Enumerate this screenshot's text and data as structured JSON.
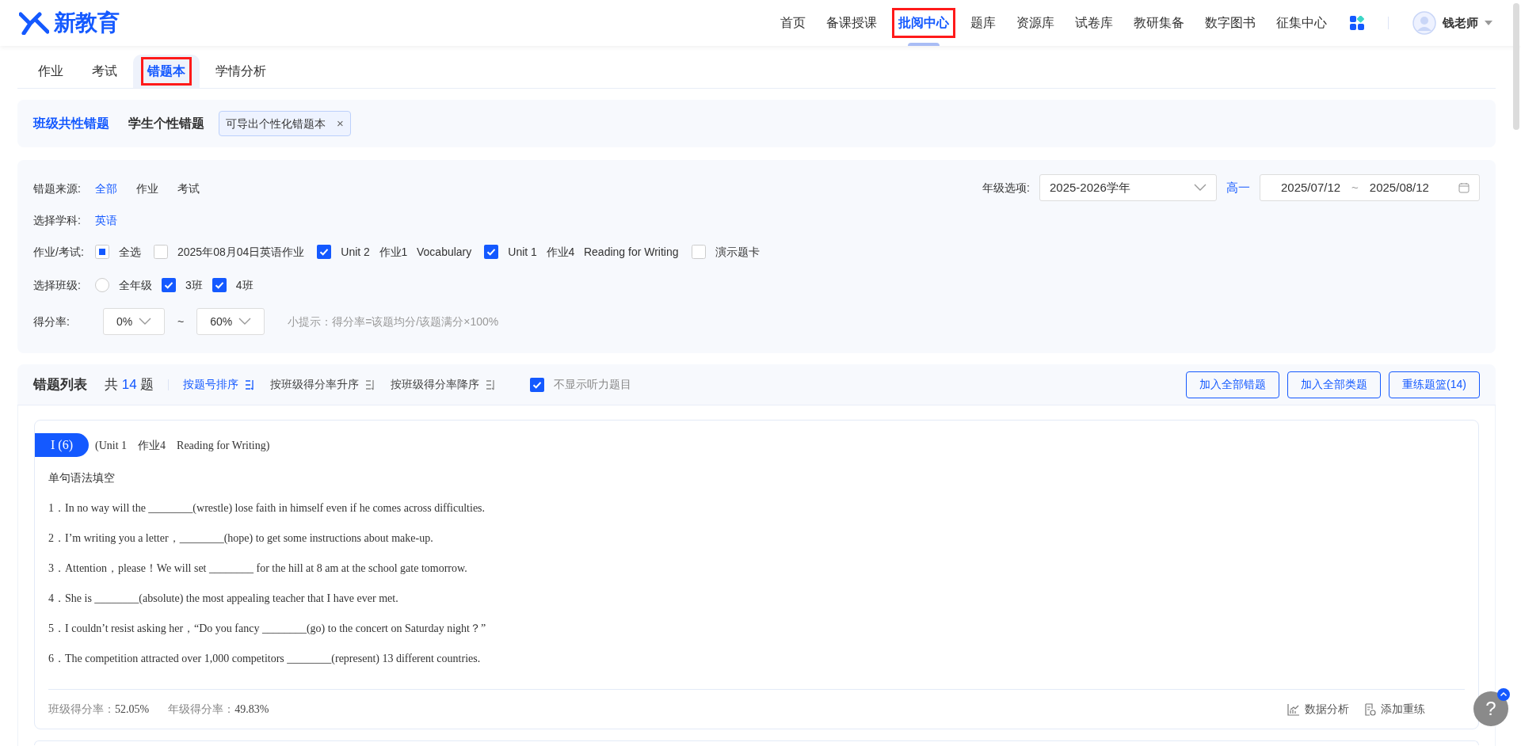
{
  "header": {
    "logo": "新教育",
    "nav": [
      {
        "label": "首页",
        "selected": false,
        "highlighted": false
      },
      {
        "label": "备课授课",
        "selected": false,
        "highlighted": false
      },
      {
        "label": "批阅中心",
        "selected": true,
        "highlighted": true
      },
      {
        "label": "题库",
        "selected": false,
        "highlighted": false
      },
      {
        "label": "资源库",
        "selected": false,
        "highlighted": false
      },
      {
        "label": "试卷库",
        "selected": false,
        "highlighted": false
      },
      {
        "label": "教研集备",
        "selected": false,
        "highlighted": false
      },
      {
        "label": "数字图书",
        "selected": false,
        "highlighted": false
      },
      {
        "label": "征集中心",
        "selected": false,
        "highlighted": false
      }
    ],
    "user": "钱老师"
  },
  "tabs": [
    {
      "label": "作业",
      "selected": false,
      "highlighted": false
    },
    {
      "label": "考试",
      "selected": false,
      "highlighted": false
    },
    {
      "label": "错题本",
      "selected": true,
      "highlighted": true
    },
    {
      "label": "学情分析",
      "selected": false,
      "highlighted": false
    }
  ],
  "modes": [
    {
      "label": "班级共性错题",
      "selected": true
    },
    {
      "label": "学生个性错题",
      "selected": false
    }
  ],
  "tip_tag": {
    "text": "可导出个性化错题本",
    "close": "×"
  },
  "filters": {
    "source": {
      "label": "错题来源:",
      "options": [
        {
          "label": "全部",
          "selected": true
        },
        {
          "label": "作业",
          "selected": false
        },
        {
          "label": "考试",
          "selected": false
        }
      ]
    },
    "subject": {
      "label": "选择学科:",
      "options": [
        {
          "label": "英语",
          "selected": true
        }
      ]
    },
    "assignments": {
      "label": "作业/考试:",
      "items": [
        {
          "parts": [
            "全选"
          ],
          "checked": false,
          "indeterminate": true
        },
        {
          "parts": [
            "2025年08月04日英语作业"
          ],
          "checked": false,
          "indeterminate": false
        },
        {
          "parts": [
            "Unit 2",
            "作业1",
            "Vocabulary"
          ],
          "checked": true,
          "indeterminate": false
        },
        {
          "parts": [
            "Unit 1",
            "作业4",
            "Reading for Writing"
          ],
          "checked": true,
          "indeterminate": false
        },
        {
          "parts": [
            "演示题卡"
          ],
          "checked": false,
          "indeterminate": false
        }
      ]
    },
    "classes": {
      "label": "选择班级:",
      "items": [
        {
          "kind": "radio",
          "label": "全年级",
          "checked": false
        },
        {
          "kind": "checkbox",
          "label": "3班",
          "checked": true
        },
        {
          "kind": "checkbox",
          "label": "4班",
          "checked": true
        }
      ]
    },
    "score": {
      "label": "得分率:",
      "from": "0%",
      "separator": "~",
      "to": "60%",
      "hint": "小提示：得分率=该题均分/该题满分×100%"
    },
    "grade": {
      "label": "年级选项:",
      "year": "2025-2026学年",
      "level": "高一",
      "date_from": "2025/07/12",
      "date_separator": "~",
      "date_to": "2025/08/12"
    }
  },
  "list": {
    "title": "错题列表",
    "count": [
      "共",
      "14",
      "题"
    ],
    "sorts": [
      {
        "label": "按题号排序",
        "selected": true
      },
      {
        "label": "按班级得分率升序",
        "selected": false
      },
      {
        "label": "按班级得分率降序",
        "selected": false
      }
    ],
    "hide_listening": {
      "label": "不显示听力题目",
      "checked": true
    },
    "buttons": [
      "加入全部错题",
      "加入全部类题",
      "重练题篮(14)"
    ],
    "questions": [
      {
        "badge": "I (6)",
        "source": "(Unit 1　作业4　Reading for Writing)",
        "type": "单句语法填空",
        "items": [
          "1．In no way will the ________(wrestle) lose faith in himself even if he comes across difficulties.",
          "2．I’m writing you a letter，________(hope) to get some instructions about make-up.",
          "3．Attention，please！We will set ________ for the hill at 8 am at the school gate tomorrow.",
          "4．She is ________(absolute) the most appealing teacher that I have ever met.",
          "5．I couldn’t resist asking her，“Do you fancy ________(go) to the concert on Saturday night？”",
          "6．The competition attracted over 1,000 competitors ________(represent) 13 different countries."
        ],
        "class_rate": {
          "label": "班级得分率：",
          "value": "52.05%"
        },
        "grade_rate": {
          "label": "年级得分率：",
          "value": "49.83%"
        },
        "actions": [
          {
            "kind": "chart",
            "label": "数据分析"
          },
          {
            "kind": "add",
            "label": "添加重练"
          }
        ]
      }
    ]
  },
  "help": "?"
}
